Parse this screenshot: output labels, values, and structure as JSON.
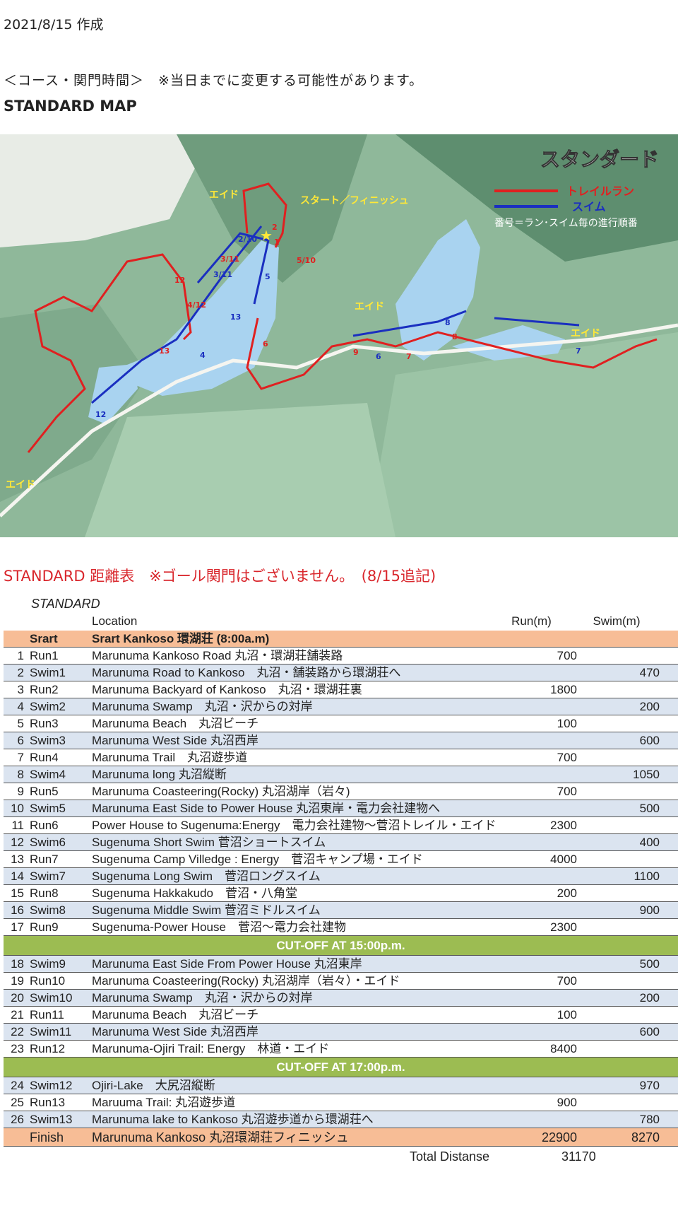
{
  "date": "2021/8/15 作成",
  "notice": "＜コース・関門時間＞　※当日までに変更する可能性があります。",
  "map_title": "STANDARD MAP",
  "map": {
    "title": "スタンダード",
    "legend_trail": "トレイルラン",
    "legend_swim": "スイム",
    "legend_note": "番号＝ラン･スイム毎の進行順番",
    "label_aid": "エイド",
    "label_start_finish": "スタート／フィニッシュ",
    "colors": {
      "trail": "#e02020",
      "swim": "#1a2fc0",
      "lake": "#a9d3f0",
      "land": "#8fb89a"
    },
    "markers": [
      "1",
      "2",
      "2/10",
      "3/11",
      "3/11",
      "4/12",
      "5",
      "5/10",
      "6",
      "7",
      "8",
      "8",
      "9",
      "6",
      "7",
      "12",
      "12",
      "13",
      "13",
      "4",
      "1"
    ]
  },
  "table_heading": "STANDARD 距離表　※ゴール関門はございません。　(8/15追記)",
  "table": {
    "caption": "STANDARD",
    "headers": {
      "location": "Location",
      "run": "Run(m)",
      "swim": "Swim(m)"
    },
    "start": {
      "seg": "Srart",
      "loc": "Srart Kankoso 環湖荘 (8:00a.m)"
    },
    "rows_a": [
      {
        "no": "1",
        "seg": "Run1",
        "loc": "Marunuma Kankoso Road 丸沼・環湖荘舗装路",
        "run": "700",
        "swim": ""
      },
      {
        "no": "2",
        "seg": "Swim1",
        "loc": "Marunuma Road to Kankoso　丸沼・舗装路から環湖荘へ",
        "run": "",
        "swim": "470"
      },
      {
        "no": "3",
        "seg": "Run2",
        "loc": "Marunuma Backyard of Kankoso　丸沼・環湖荘裏",
        "run": "1800",
        "swim": ""
      },
      {
        "no": "4",
        "seg": "Swim2",
        "loc": "Marunuma Swamp　丸沼・沢からの対岸",
        "run": "",
        "swim": "200"
      },
      {
        "no": "5",
        "seg": "Run3",
        "loc": "Marunuma Beach　丸沼ビーチ",
        "run": "100",
        "swim": ""
      },
      {
        "no": "6",
        "seg": "Swim3",
        "loc": "Marunuma West Side 丸沼西岸",
        "run": "",
        "swim": "600"
      },
      {
        "no": "7",
        "seg": "Run4",
        "loc": "Marunuma Trail　丸沼遊歩道",
        "run": "700",
        "swim": ""
      },
      {
        "no": "8",
        "seg": "Swim4",
        "loc": "Marunuma long 丸沼縦断",
        "run": "",
        "swim": "1050"
      },
      {
        "no": "9",
        "seg": "Run5",
        "loc": "Marunuma Coasteering(Rocky) 丸沼湖岸（岩々)",
        "run": "700",
        "swim": ""
      },
      {
        "no": "10",
        "seg": "Swim5",
        "loc": "Marunuma East Side to Power House 丸沼東岸・電力会社建物へ",
        "run": "",
        "swim": "500"
      },
      {
        "no": "11",
        "seg": "Run6",
        "loc": "Power House to Sugenuma:Energy　電力会社建物～菅沼トレイル・エイド",
        "run": "2300",
        "swim": ""
      },
      {
        "no": "12",
        "seg": "Swim6",
        "loc": "Sugenuma Short Swim 菅沼ショートスイム",
        "run": "",
        "swim": "400"
      },
      {
        "no": "13",
        "seg": "Run7",
        "loc": "Sugenuma Camp Villedge : Energy　菅沼キャンプ場・エイド",
        "run": "4000",
        "swim": ""
      },
      {
        "no": "14",
        "seg": "Swim7",
        "loc": "Sugenuma Long Swim　菅沼ロングスイム",
        "run": "",
        "swim": "1100"
      },
      {
        "no": "15",
        "seg": "Run8",
        "loc": "Sugenuma Hakkakudo　菅沼・八角堂",
        "run": "200",
        "swim": ""
      },
      {
        "no": "16",
        "seg": "Swim8",
        "loc": "Sugenuma Middle Swim 菅沼ミドルスイム",
        "run": "",
        "swim": "900"
      },
      {
        "no": "17",
        "seg": "Run9",
        "loc": "Sugenuma-Power House　菅沼～電力会社建物",
        "run": "2300",
        "swim": ""
      }
    ],
    "cutoff_1": "CUT-OFF AT 15:00p.m.",
    "rows_b": [
      {
        "no": "18",
        "seg": "Swim9",
        "loc": "Marunuma East Side From Power House 丸沼東岸",
        "run": "",
        "swim": "500"
      },
      {
        "no": "19",
        "seg": "Run10",
        "loc": "Marunuma Coasteering(Rocky) 丸沼湖岸（岩々）・エイド",
        "run": "700",
        "swim": ""
      },
      {
        "no": "20",
        "seg": "Swim10",
        "loc": "Marunuma Swamp　丸沼・沢からの対岸",
        "run": "",
        "swim": "200"
      },
      {
        "no": "21",
        "seg": "Run11",
        "loc": "Marunuma Beach　丸沼ビーチ",
        "run": "100",
        "swim": ""
      },
      {
        "no": "22",
        "seg": "Swim11",
        "loc": "Marunuma West Side 丸沼西岸",
        "run": "",
        "swim": "600"
      },
      {
        "no": "23",
        "seg": "Run12",
        "loc": "Marunuma-Ojiri Trail: Energy　林道・エイド",
        "run": "8400",
        "swim": ""
      }
    ],
    "cutoff_2": "CUT-OFF AT 17:00p.m.",
    "rows_c": [
      {
        "no": "24",
        "seg": "Swim12",
        "loc": "Ojiri-Lake　大尻沼縦断",
        "run": "",
        "swim": "970"
      },
      {
        "no": "25",
        "seg": "Run13",
        "loc": "Maruuma Trail: 丸沼遊歩道",
        "run": "900",
        "swim": ""
      },
      {
        "no": "26",
        "seg": "Swim13",
        "loc": "Marunuma lake to Kankoso 丸沼遊歩道から環湖荘へ",
        "run": "",
        "swim": "780"
      }
    ],
    "finish": {
      "seg": "Finish",
      "loc": "Marunuma Kankoso 丸沼環湖荘フィニッシュ",
      "run": "22900",
      "swim": "8270"
    },
    "total": {
      "label": "Total Distanse",
      "value": "31170"
    }
  }
}
